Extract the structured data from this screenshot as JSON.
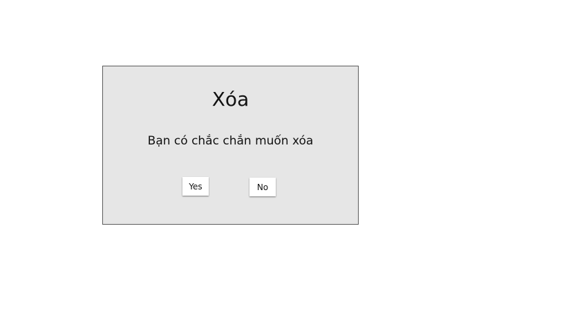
{
  "dialog": {
    "title": "Xóa",
    "message": "Bạn có chắc chắn muốn xóa",
    "buttons": {
      "yes_label": "Yes",
      "no_label": "No"
    }
  },
  "colors": {
    "dialog_background": "#e6e6e6",
    "dialog_border": "#5a5a5a",
    "button_background": "#ffffff",
    "text": "#111111"
  }
}
